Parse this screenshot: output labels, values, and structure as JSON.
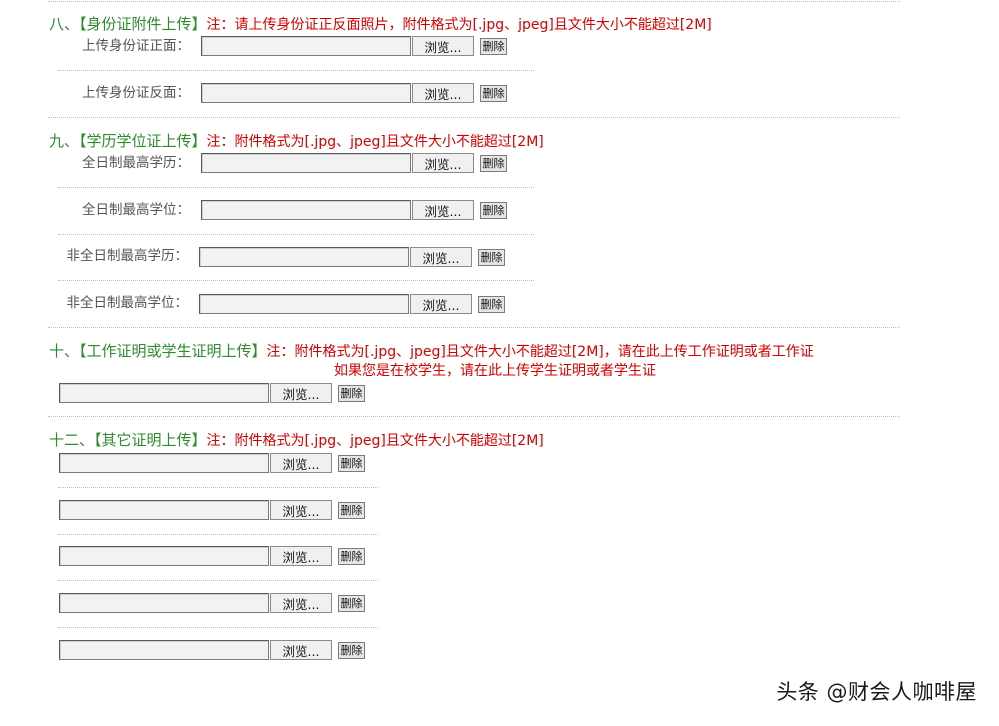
{
  "common": {
    "browse_label": "浏览...",
    "delete_label": "删除"
  },
  "section8": {
    "title": "八、【身份证附件上传】",
    "note": "注：请上传身份证正反面照片，附件格式为[.jpg、jpeg]且文件大小不能超过[2M]",
    "rows": [
      {
        "label": "上传身份证正面："
      },
      {
        "label": "上传身份证反面："
      }
    ]
  },
  "section9": {
    "title": "九、【学历学位证上传】",
    "note": "注：附件格式为[.jpg、jpeg]且文件大小不能超过[2M]",
    "rows": [
      {
        "label": "全日制最高学历："
      },
      {
        "label": "全日制最高学位："
      },
      {
        "label": "非全日制最高学历："
      },
      {
        "label": "非全日制最高学位："
      }
    ]
  },
  "section10": {
    "title": "十、【工作证明或学生证明上传】",
    "note": "注：附件格式为[.jpg、jpeg]且文件大小不能超过[2M]，请在此上传工作证明或者工作证",
    "note2": "如果您是在校学生，请在此上传学生证明或者学生证"
  },
  "section12": {
    "title": "十二、【其它证明上传】",
    "note": "注：附件格式为[.jpg、jpeg]且文件大小不能超过[2M]"
  },
  "watermark": "头条 @财会人咖啡屋"
}
